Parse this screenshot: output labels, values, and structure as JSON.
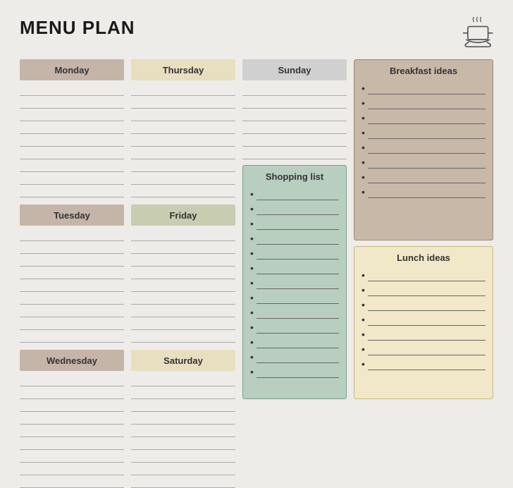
{
  "title": "MENU PLAN",
  "days": [
    {
      "id": "monday",
      "label": "Monday",
      "colorClass": "monday",
      "lines": 9
    },
    {
      "id": "tuesday",
      "label": "Tuesday",
      "colorClass": "tuesday",
      "lines": 9
    },
    {
      "id": "wednesday",
      "label": "Wednesday",
      "colorClass": "wednesday",
      "lines": 9
    }
  ],
  "days2": [
    {
      "id": "thursday",
      "label": "Thursday",
      "colorClass": "thursday",
      "lines": 9
    },
    {
      "id": "friday",
      "label": "Friday",
      "colorClass": "friday",
      "lines": 9
    },
    {
      "id": "saturday",
      "label": "Saturday",
      "colorClass": "saturday",
      "lines": 9
    }
  ],
  "sunday": {
    "label": "Sunday",
    "colorClass": "sunday",
    "lines": 6
  },
  "shopping": {
    "label": "Shopping list",
    "items": 13
  },
  "breakfast": {
    "label": "Breakfast ideas",
    "items": 8
  },
  "lunch": {
    "label": "Lunch ideas",
    "items": 7
  }
}
